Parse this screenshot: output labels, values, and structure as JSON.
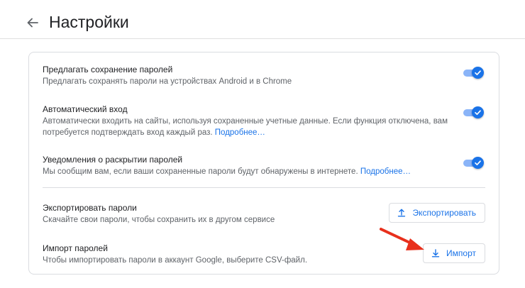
{
  "header": {
    "title": "Настройки",
    "back_icon": "arrow-left-icon"
  },
  "settings": {
    "offer_save": {
      "title": "Предлагать сохранение паролей",
      "description": "Предлагать сохранять пароли на устройствах Android и в Chrome",
      "enabled": true
    },
    "auto_signin": {
      "title": "Автоматический вход",
      "description_line1": "Автоматически входить на сайты, используя сохраненные учетные данные. Если функция отключена, вам",
      "description_line2": "потребуется подтверждать вход каждый раз.",
      "link": "Подробнее…",
      "enabled": true
    },
    "breach_alerts": {
      "title": "Уведомления о раскрытии паролей",
      "description": "Мы сообщим вам, если ваши сохраненные пароли будут обнаружены в интернете.",
      "link": "Подробнее…",
      "enabled": true
    },
    "export": {
      "title": "Экспортировать пароли",
      "description": "Скачайте свои пароли, чтобы сохранить их в другом сервисе",
      "button_label": "Экспортировать",
      "button_icon": "upload-icon"
    },
    "import": {
      "title": "Импорт паролей",
      "description": "Чтобы импортировать пароли в аккаунт Google, выберите CSV-файл.",
      "button_label": "Импорт",
      "button_icon": "download-icon"
    }
  },
  "colors": {
    "accent": "#1a73e8",
    "toggle_track": "#8ab4f8",
    "annotation_arrow": "#e8301c"
  }
}
